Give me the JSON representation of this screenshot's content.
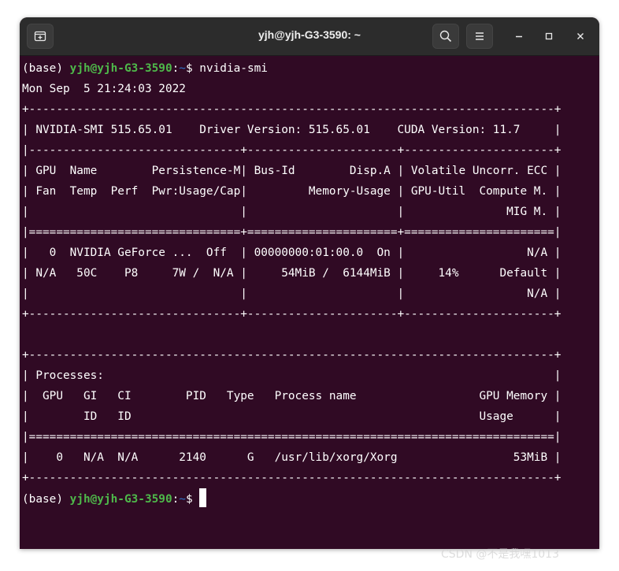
{
  "window": {
    "title": "yjh@yjh-G3-3590: ~"
  },
  "prompt": {
    "env": "(base) ",
    "user_host": "yjh@yjh-G3-3590",
    "sep": ":",
    "path": "~",
    "symbol": "$ "
  },
  "command": "nvidia-smi",
  "output_lines": [
    "Mon Sep  5 21:24:03 2022",
    "+-----------------------------------------------------------------------------+",
    "| NVIDIA-SMI 515.65.01    Driver Version: 515.65.01    CUDA Version: 11.7     |",
    "|-------------------------------+----------------------+----------------------+",
    "| GPU  Name        Persistence-M| Bus-Id        Disp.A | Volatile Uncorr. ECC |",
    "| Fan  Temp  Perf  Pwr:Usage/Cap|         Memory-Usage | GPU-Util  Compute M. |",
    "|                               |                      |               MIG M. |",
    "|===============================+======================+======================|",
    "|   0  NVIDIA GeForce ...  Off  | 00000000:01:00.0  On |                  N/A |",
    "| N/A   50C    P8     7W /  N/A |     54MiB /  6144MiB |     14%      Default |",
    "|                               |                      |                  N/A |",
    "+-------------------------------+----------------------+----------------------+",
    "",
    "+-----------------------------------------------------------------------------+",
    "| Processes:                                                                  |",
    "|  GPU   GI   CI        PID   Type   Process name                  GPU Memory |",
    "|        ID   ID                                                   Usage      |",
    "|=============================================================================|",
    "|    0   N/A  N/A      2140      G   /usr/lib/xorg/Xorg                 53MiB |",
    "+-----------------------------------------------------------------------------+"
  ],
  "icons": {
    "new_tab": "new-tab-icon",
    "search": "search-icon",
    "menu": "hamburger-menu-icon",
    "minimize": "minimize-icon",
    "maximize": "maximize-icon",
    "close": "close-icon"
  },
  "colors": {
    "terminal_bg": "#300a24",
    "titlebar_bg": "#2c2c2c",
    "prompt_user": "#4eb84a",
    "prompt_path": "#2d73c9",
    "text": "#ffffff"
  },
  "watermark": "CSDN @不是我嘿1013"
}
